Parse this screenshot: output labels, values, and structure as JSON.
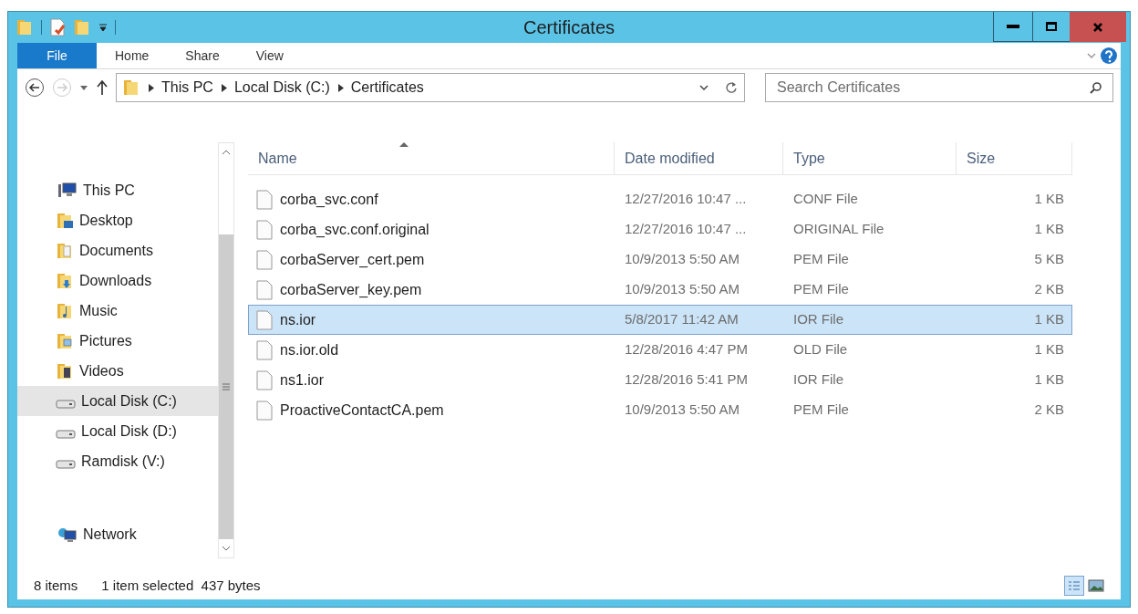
{
  "window": {
    "title": "Certificates"
  },
  "ribbon_tabs": [
    {
      "label": "File",
      "selected": true
    },
    {
      "label": "Home",
      "selected": false
    },
    {
      "label": "Share",
      "selected": false
    },
    {
      "label": "View",
      "selected": false
    }
  ],
  "address_bar": {
    "crumbs": [
      "This PC",
      "Local Disk (C:)",
      "Certificates"
    ]
  },
  "search": {
    "placeholder": "Search Certificates"
  },
  "sidebar": {
    "items": [
      {
        "label": "This PC",
        "kind": "pc",
        "selected": false,
        "children": [
          {
            "label": "Desktop",
            "kind": "desktop",
            "selected": false
          },
          {
            "label": "Documents",
            "kind": "documents",
            "selected": false
          },
          {
            "label": "Downloads",
            "kind": "downloads",
            "selected": false
          },
          {
            "label": "Music",
            "kind": "music",
            "selected": false
          },
          {
            "label": "Pictures",
            "kind": "pictures",
            "selected": false
          },
          {
            "label": "Videos",
            "kind": "videos",
            "selected": false
          },
          {
            "label": "Local Disk (C:)",
            "kind": "drive",
            "selected": true
          },
          {
            "label": "Local Disk (D:)",
            "kind": "drive",
            "selected": false
          },
          {
            "label": "Ramdisk (V:)",
            "kind": "drive",
            "selected": false
          }
        ]
      },
      {
        "label": "Network",
        "kind": "network",
        "selected": false
      }
    ]
  },
  "table": {
    "columns": [
      "Name",
      "Date modified",
      "Type",
      "Size"
    ],
    "rows": [
      {
        "name": "corba_svc.conf",
        "date": "12/27/2016 10:47 ...",
        "type": "CONF File",
        "size": "1 KB",
        "selected": false
      },
      {
        "name": "corba_svc.conf.original",
        "date": "12/27/2016 10:47 ...",
        "type": "ORIGINAL File",
        "size": "1 KB",
        "selected": false
      },
      {
        "name": "corbaServer_cert.pem",
        "date": "10/9/2013 5:50 AM",
        "type": "PEM File",
        "size": "5 KB",
        "selected": false
      },
      {
        "name": "corbaServer_key.pem",
        "date": "10/9/2013 5:50 AM",
        "type": "PEM File",
        "size": "2 KB",
        "selected": false
      },
      {
        "name": "ns.ior",
        "date": "5/8/2017 11:42 AM",
        "type": "IOR File",
        "size": "1 KB",
        "selected": true
      },
      {
        "name": "ns.ior.old",
        "date": "12/28/2016 4:47 PM",
        "type": "OLD File",
        "size": "1 KB",
        "selected": false
      },
      {
        "name": "ns1.ior",
        "date": "12/28/2016 5:41 PM",
        "type": "IOR File",
        "size": "1 KB",
        "selected": false
      },
      {
        "name": "ProactiveContactCA.pem",
        "date": "10/9/2013 5:50 AM",
        "type": "PEM File",
        "size": "2 KB",
        "selected": false
      }
    ]
  },
  "status_bar": {
    "count": "8 items",
    "selection": "1 item selected  437 bytes"
  }
}
